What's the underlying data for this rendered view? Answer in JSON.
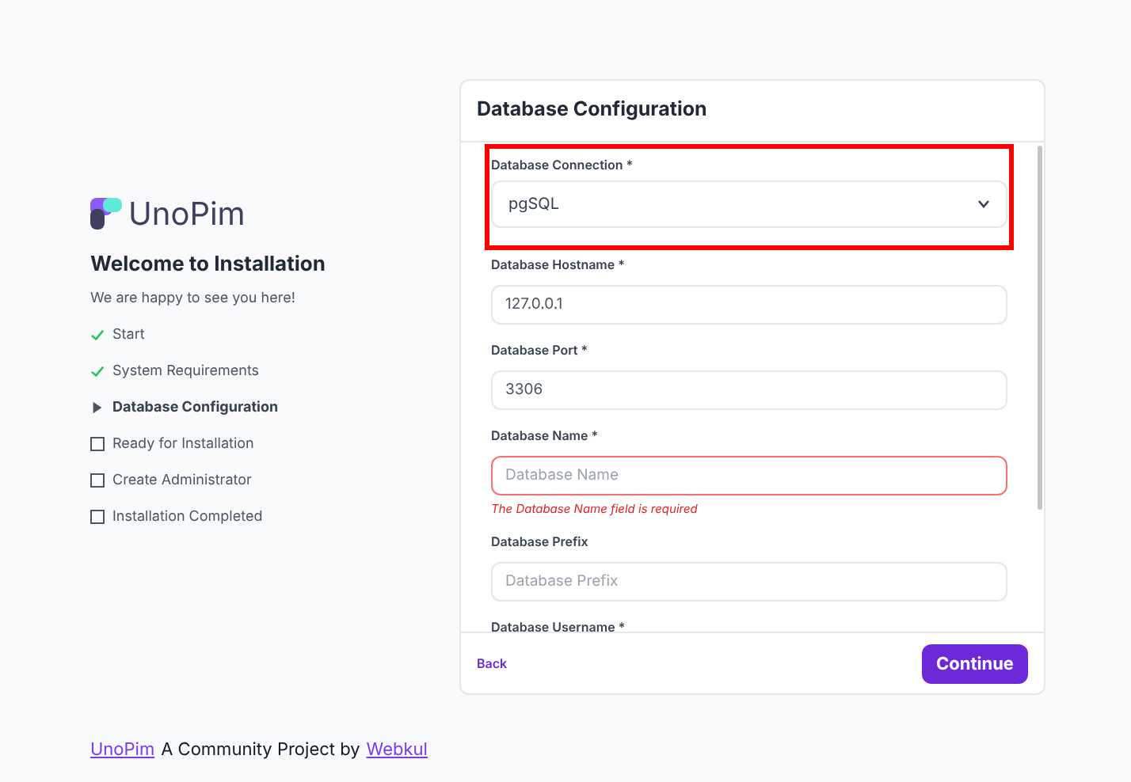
{
  "brand": {
    "name": "UnoPim"
  },
  "welcome": {
    "title": "Welcome to Installation",
    "subtitle": "We are happy to see you here!"
  },
  "steps": [
    {
      "label": "Start",
      "kind": "done"
    },
    {
      "label": "System Requirements",
      "kind": "done"
    },
    {
      "label": "Database Configuration",
      "kind": "current"
    },
    {
      "label": "Ready for Installation",
      "kind": "pending"
    },
    {
      "label": "Create Administrator",
      "kind": "pending"
    },
    {
      "label": "Installation Completed",
      "kind": "pending"
    }
  ],
  "card": {
    "title": "Database Configuration",
    "fields": [
      {
        "kind": "select",
        "label": "Database Connection *",
        "value": "pgSQL",
        "highlighted": true
      },
      {
        "kind": "input",
        "label": "Database Hostname *",
        "value": "127.0.0.1"
      },
      {
        "kind": "input",
        "label": "Database Port *",
        "value": "3306"
      },
      {
        "kind": "input",
        "label": "Database Name *",
        "placeholder": "Database Name",
        "error": "The Database Name field is required"
      },
      {
        "kind": "input",
        "label": "Database Prefix",
        "placeholder": "Database Prefix"
      },
      {
        "kind": "label",
        "label": "Database Username *"
      }
    ],
    "back": "Back",
    "continue": "Continue"
  },
  "footer": {
    "link_1": "UnoPim",
    "text": "A Community Project by",
    "link_2": "Webkul"
  }
}
